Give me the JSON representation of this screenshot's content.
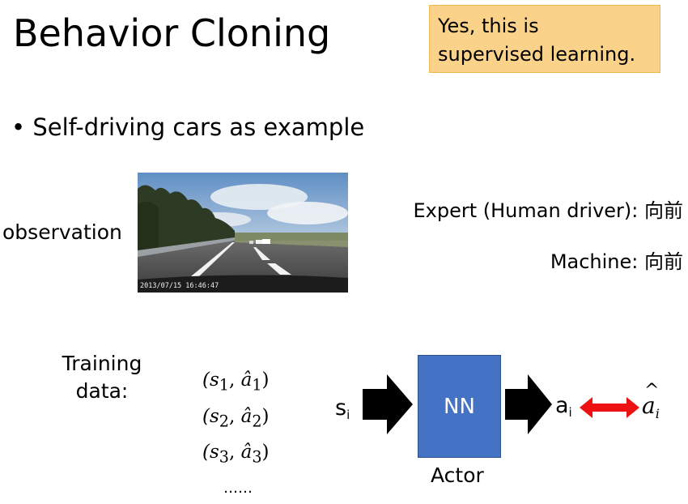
{
  "slide": {
    "title": "Behavior Cloning",
    "note_line1": "Yes, this is",
    "note_line2": "supervised learning.",
    "bullet": "Self-driving cars as example",
    "observation_label": "observation",
    "photo_timestamp": "2013/07/15 16:46:47",
    "expert_text": "Expert (Human driver): 向前",
    "machine_text": "Machine: 向前",
    "training_line1": "Training",
    "training_line2": "data:",
    "pairs": [
      "(s",
      "(s",
      "(s"
    ],
    "pair_indices": [
      "1",
      "2",
      "3"
    ],
    "ellipsis": "……",
    "state_symbol": "s",
    "state_sub": "i",
    "nn_label": "NN",
    "actor_label": "Actor",
    "action_symbol": "a",
    "action_sub": "i",
    "target_symbol": "a",
    "target_sub": "i"
  },
  "colors": {
    "note_bg": "#fbd28a",
    "nn_box": "#4472c4",
    "compare_arrow": "#ee1111"
  }
}
